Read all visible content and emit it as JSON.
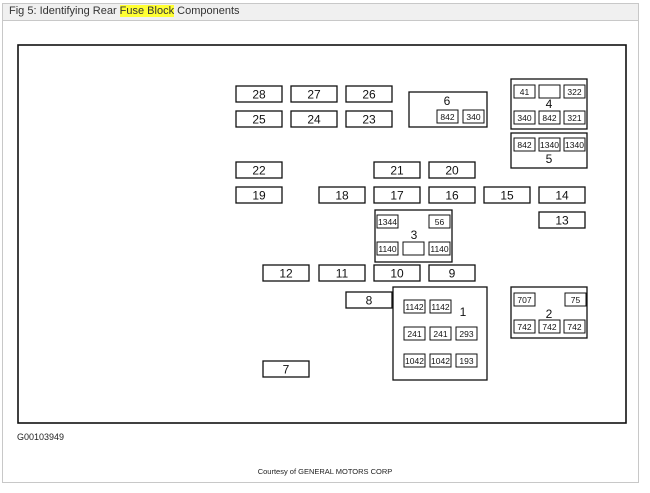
{
  "title": {
    "prefix": "Fig 5: Identifying Rear ",
    "highlight": "Fuse Block",
    "suffix": " Components"
  },
  "figure_id": "G00103949",
  "courtesy": "Courtesy of GENERAL MOTORS CORP",
  "fuses": [
    "28",
    "27",
    "26",
    "25",
    "24",
    "23",
    "22",
    "21",
    "20",
    "19",
    "18",
    "17",
    "16",
    "15",
    "14",
    "13",
    "12",
    "11",
    "10",
    "9",
    "8",
    "7"
  ],
  "relays": {
    "r1": {
      "label": "1",
      "cells": [
        "1142",
        "1142",
        "241",
        "241",
        "293",
        "1042",
        "1042",
        "193"
      ]
    },
    "r2": {
      "label": "2",
      "cells": [
        "707",
        "75",
        "742",
        "742",
        "742"
      ]
    },
    "r3": {
      "label": "3",
      "cells": [
        "1344",
        "56",
        "1140",
        "",
        "1140"
      ]
    },
    "r4": {
      "label": "4",
      "cells": [
        "41",
        "",
        "322",
        "340",
        "842",
        "321"
      ]
    },
    "r5": {
      "label": "5",
      "cells": [
        "842",
        "1340",
        "1340"
      ]
    },
    "r6": {
      "label": "6",
      "cells": [
        "842",
        "340"
      ]
    }
  }
}
